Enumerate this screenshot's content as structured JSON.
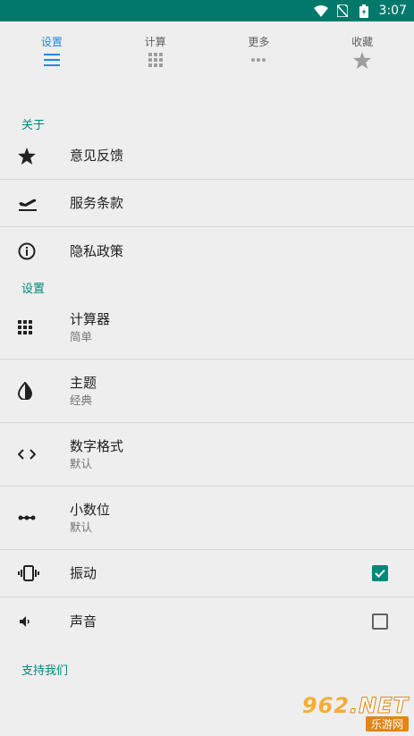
{
  "status": {
    "time": "3:07"
  },
  "tabs": [
    {
      "label": "设置",
      "icon": "menu-icon",
      "active": true
    },
    {
      "label": "计算",
      "icon": "grid-icon",
      "active": false
    },
    {
      "label": "更多",
      "icon": "more-dots-icon",
      "active": false
    },
    {
      "label": "收藏",
      "icon": "star-icon",
      "active": false
    }
  ],
  "about": {
    "header": "关于",
    "items": [
      {
        "title": "意见反馈",
        "icon": "star-icon"
      },
      {
        "title": "服务条款",
        "icon": "flight-takeoff-icon"
      },
      {
        "title": "隐私政策",
        "icon": "info-icon"
      }
    ]
  },
  "settings": {
    "header": "设置",
    "items": [
      {
        "title": "计算器",
        "sub": "简单",
        "icon": "keypad-icon"
      },
      {
        "title": "主题",
        "sub": "经典",
        "icon": "contrast-icon"
      },
      {
        "title": "数字格式",
        "sub": "默认",
        "icon": "code-icon"
      },
      {
        "title": "小数位",
        "sub": "默认",
        "icon": "decimal-icon"
      },
      {
        "title": "振动",
        "icon": "vibration-icon",
        "checked": true
      },
      {
        "title": "声音",
        "icon": "volume-icon",
        "checked": false
      }
    ]
  },
  "support": {
    "label": "支持我们"
  },
  "watermark": {
    "top": "962",
    "top_suffix": ".NET",
    "bottom": "乐游网"
  },
  "colors": {
    "accent": "#00897b",
    "statusbar": "#00796b",
    "active_tab": "#1e88e5"
  }
}
